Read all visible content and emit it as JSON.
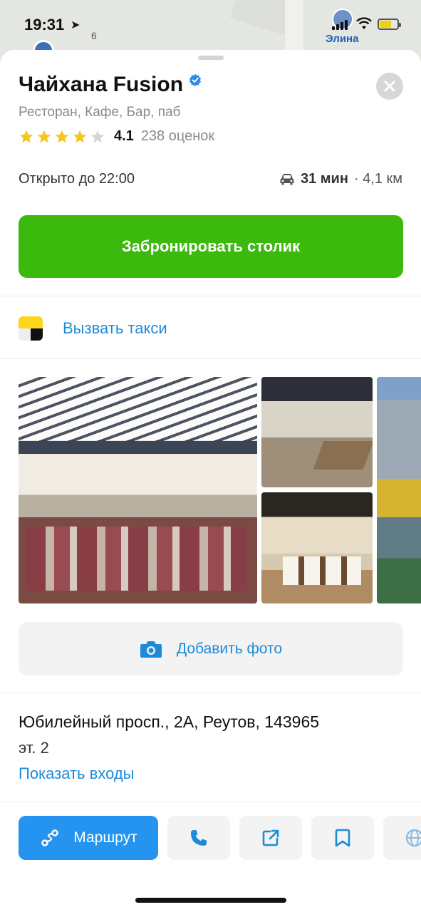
{
  "status_bar": {
    "time": "19:31",
    "location_icon": "navigation-arrow-icon",
    "user_name": "Элина"
  },
  "map": {
    "house_number": "6"
  },
  "place": {
    "name": "Чайхана Fusion",
    "verified": true,
    "category": "Ресторан, Кафе, Бар, паб",
    "rating_stars_filled": 4,
    "rating_stars_total": 5,
    "rating": "4.1",
    "rating_count": "238 оценок",
    "hours": "Открыто до 22:00",
    "travel_time": "31 мин",
    "distance": "· 4,1 км"
  },
  "actions": {
    "book_label": "Забронировать столик",
    "taxi_label": "Вызвать такси",
    "add_photo_label": "Добавить фото",
    "route_label": "Маршрут"
  },
  "address": {
    "line": "Юбилейный просп., 2А, Реутов, 143965",
    "floor": "эт. 2",
    "entrances_link": "Показать входы"
  },
  "colors": {
    "primary_green": "#3bb90c",
    "link_blue": "#1d8bd9",
    "route_blue": "#2494f0",
    "star_yellow": "#f5c518"
  },
  "icons": {
    "close": "close-icon",
    "verified": "verified-check-icon",
    "car": "car-icon",
    "taxi": "yandex-taxi-icon",
    "camera": "camera-icon",
    "route": "route-icon",
    "phone": "phone-icon",
    "share": "share-icon",
    "bookmark": "bookmark-icon",
    "website": "globe-icon"
  }
}
